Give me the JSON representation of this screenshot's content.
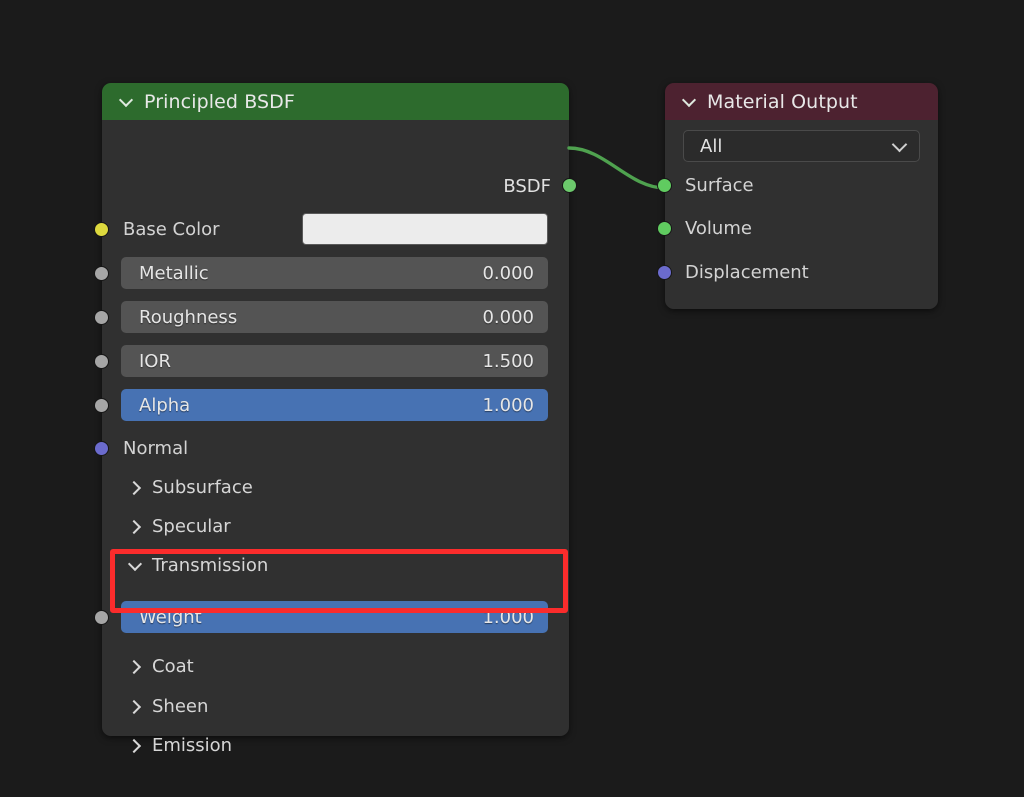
{
  "canvas": {
    "background": "#1b1b1b",
    "editor": "blender-shader-node-editor"
  },
  "nodes": {
    "principled": {
      "title": "Principled BSDF",
      "header_color": "#2d6b2d",
      "body_color": "#303030",
      "collapse_icon": "chevron-down-icon",
      "outputs": [
        {
          "name": "BSDF",
          "label": "BSDF",
          "socket_color": "#6cc96c"
        }
      ],
      "base_color": {
        "label": "Base Color",
        "socket_color": "#ddd93e",
        "swatch_color": "#ececec"
      },
      "sliders": [
        {
          "label": "Metallic",
          "value": "0.000",
          "socket_color": "#a6a6a6",
          "active": false
        },
        {
          "label": "Roughness",
          "value": "0.000",
          "socket_color": "#a6a6a6",
          "active": false
        },
        {
          "label": "IOR",
          "value": "1.500",
          "socket_color": "#a6a6a6",
          "active": false
        },
        {
          "label": "Alpha",
          "value": "1.000",
          "socket_color": "#a6a6a6",
          "active": true
        }
      ],
      "normal": {
        "label": "Normal",
        "socket_color": "#6b6bcd"
      },
      "panels_upper": [
        {
          "label": "Subsurface",
          "expanded": false,
          "icon": "chevron-right-icon"
        },
        {
          "label": "Specular",
          "expanded": false,
          "icon": "chevron-right-icon"
        },
        {
          "label": "Transmission",
          "expanded": true,
          "icon": "chevron-down-icon"
        }
      ],
      "transmission_weight": {
        "label": "Weight",
        "value": "1.000",
        "socket_color": "#a6a6a6",
        "active": true,
        "highlighted": true,
        "highlight_color": "#fb2c2c"
      },
      "panels_lower": [
        {
          "label": "Coat",
          "expanded": false,
          "icon": "chevron-right-icon"
        },
        {
          "label": "Sheen",
          "expanded": false,
          "icon": "chevron-right-icon"
        },
        {
          "label": "Emission",
          "expanded": false,
          "icon": "chevron-right-icon"
        }
      ]
    },
    "material_output": {
      "title": "Material Output",
      "header_color": "#4d2230",
      "body_color": "#303030",
      "collapse_icon": "chevron-down-icon",
      "target_dropdown": {
        "value": "All",
        "icon": "chevron-down-icon"
      },
      "inputs": [
        {
          "label": "Surface",
          "socket_color": "#60cb60"
        },
        {
          "label": "Volume",
          "socket_color": "#60cb60"
        },
        {
          "label": "Displacement",
          "socket_color": "#6b6bcd"
        }
      ]
    }
  },
  "link": {
    "from": "Principled BSDF / BSDF",
    "to": "Material Output / Surface",
    "color": "#4fa24f"
  }
}
